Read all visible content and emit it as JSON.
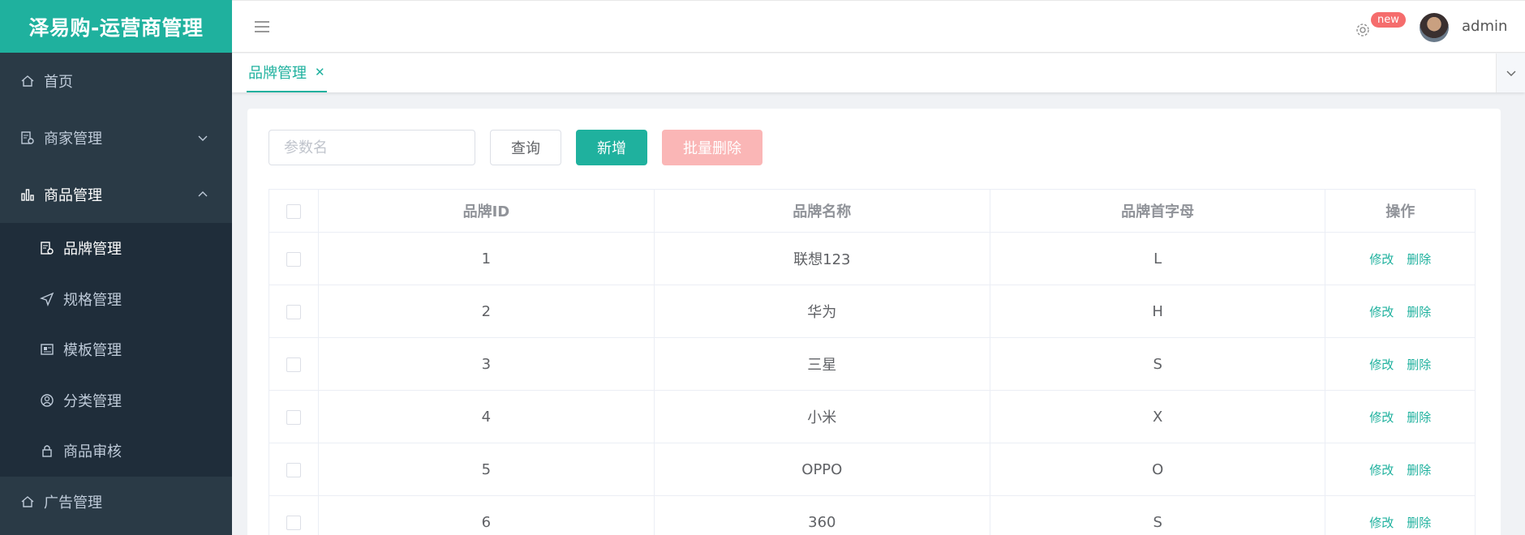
{
  "app": {
    "brand_title": "泽易购-运营商管理"
  },
  "sidebar": {
    "items": [
      {
        "label": "首页",
        "icon": "home-icon"
      },
      {
        "label": "商家管理",
        "icon": "document-settings-icon"
      },
      {
        "label": "商品管理",
        "icon": "bar-chart-icon"
      },
      {
        "label": "广告管理",
        "icon": "home-icon"
      }
    ],
    "subitems": [
      {
        "label": "品牌管理",
        "icon": "document-settings-icon"
      },
      {
        "label": "规格管理",
        "icon": "send-icon"
      },
      {
        "label": "模板管理",
        "icon": "picture-icon"
      },
      {
        "label": "分类管理",
        "icon": "user-icon"
      },
      {
        "label": "商品审核",
        "icon": "lock-icon"
      }
    ]
  },
  "header": {
    "badge": "new",
    "username": "admin"
  },
  "tabs": {
    "active_label": "品牌管理"
  },
  "toolbar": {
    "search_placeholder": "参数名",
    "query_label": "查询",
    "add_label": "新增",
    "batch_delete_label": "批量删除"
  },
  "table": {
    "headers": {
      "id": "品牌ID",
      "name": "品牌名称",
      "letter": "品牌首字母",
      "ops": "操作"
    },
    "rows": [
      {
        "id": "1",
        "name": "联想123",
        "letter": "L",
        "edit": "修改",
        "delete": "删除"
      },
      {
        "id": "2",
        "name": "华为",
        "letter": "H",
        "edit": "修改",
        "delete": "删除"
      },
      {
        "id": "3",
        "name": "三星",
        "letter": "S",
        "edit": "修改",
        "delete": "删除"
      },
      {
        "id": "4",
        "name": "小米",
        "letter": "X",
        "edit": "修改",
        "delete": "删除"
      },
      {
        "id": "5",
        "name": "OPPO",
        "letter": "O",
        "edit": "修改",
        "delete": "删除"
      },
      {
        "id": "6",
        "name": "360",
        "letter": "S",
        "edit": "修改",
        "delete": "删除"
      }
    ]
  },
  "colors": {
    "accent": "#1fb19e",
    "sidebar": "#2a3a46",
    "danger_light": "#fab6b6",
    "badge": "#f56c6c"
  }
}
